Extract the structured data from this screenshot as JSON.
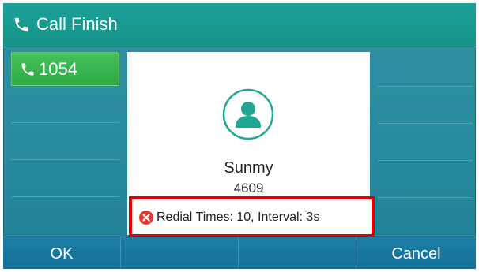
{
  "header": {
    "title": "Call Finish",
    "icon": "phone-icon"
  },
  "line_keys": [
    {
      "label": "1054",
      "icon": "phone-icon",
      "color": "#34ad49"
    }
  ],
  "call_info": {
    "avatar_icon": "contact-avatar-icon",
    "name": "Sunmy",
    "number": "4609",
    "redial_status": "Redial Times: 10, Interval: 3s",
    "status_icon": "error-x-icon"
  },
  "softkeys": {
    "items": [
      {
        "label": "OK"
      },
      {
        "label": ""
      },
      {
        "label": ""
      },
      {
        "label": "Cancel"
      }
    ]
  },
  "colors": {
    "accent_teal": "#1ba19a",
    "softkey_blue": "#1c7fa7",
    "highlight_red": "#e00000"
  }
}
